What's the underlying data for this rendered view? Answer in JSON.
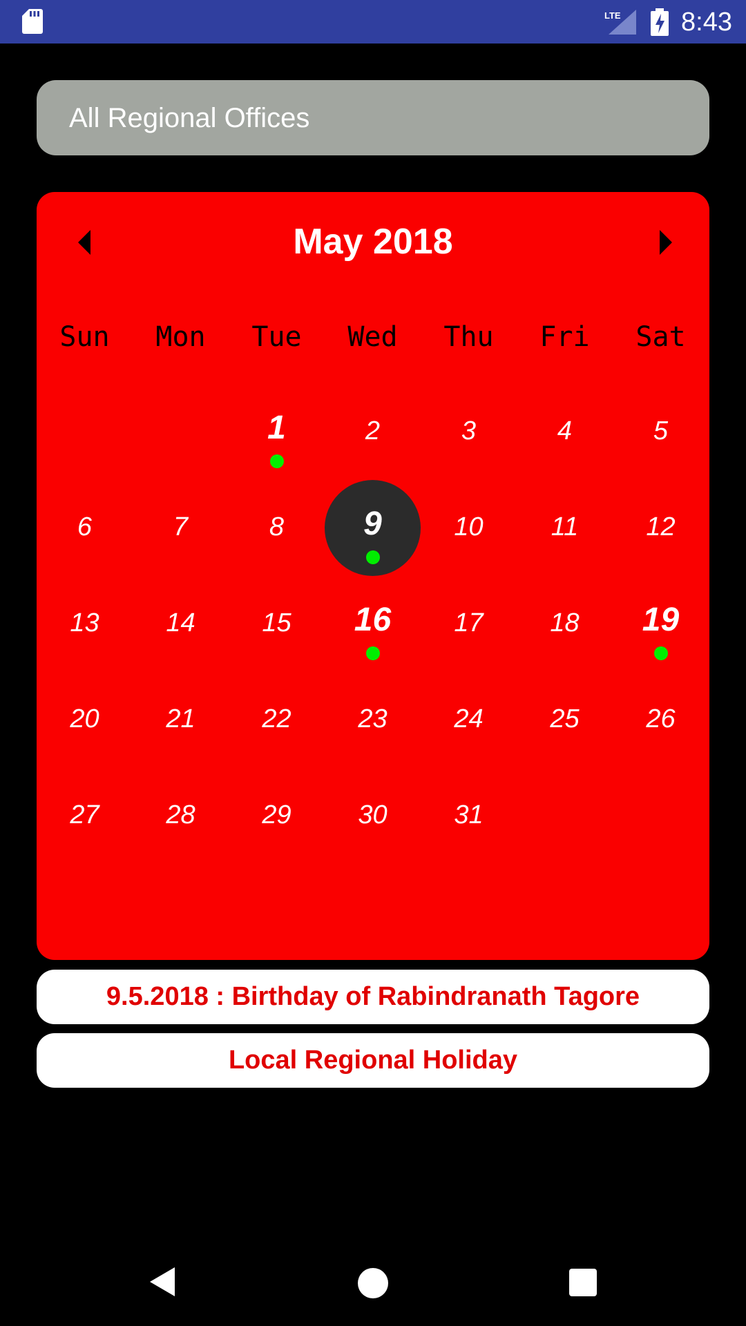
{
  "status_bar": {
    "time": "8:43",
    "network": "LTE",
    "icons": [
      "sd-card-icon",
      "lte-signal-icon",
      "battery-charging-icon"
    ],
    "color": "#303F9F"
  },
  "region_selector": {
    "value": "All Regional Offices",
    "color": "#A2A6A0"
  },
  "calendar": {
    "month_title": "May 2018",
    "prev_icon": "chevron-left-icon",
    "next_icon": "chevron-right-icon",
    "weekdays": [
      "Sun",
      "Mon",
      "Tue",
      "Wed",
      "Thu",
      "Fri",
      "Sat"
    ],
    "first_weekday_index": 2,
    "days_in_month": 31,
    "days": [
      "1",
      "2",
      "3",
      "4",
      "5",
      "6",
      "7",
      "8",
      "9",
      "10",
      "11",
      "12",
      "13",
      "14",
      "15",
      "16",
      "17",
      "18",
      "19",
      "20",
      "21",
      "22",
      "23",
      "24",
      "25",
      "26",
      "27",
      "28",
      "29",
      "30",
      "31"
    ],
    "event_days": [
      1,
      9,
      16,
      19
    ],
    "selected_day": 9,
    "background_color": "#FA0000",
    "event_dot_color": "#00EE00",
    "selected_color": "#2B2B2B"
  },
  "events": [
    {
      "text": "9.5.2018 : Birthday of Rabindranath Tagore"
    },
    {
      "text": "Local Regional Holiday"
    }
  ],
  "event_text_color": "#E00000",
  "nav_bar": {
    "icons": [
      "back-icon",
      "home-icon",
      "recents-icon"
    ]
  }
}
